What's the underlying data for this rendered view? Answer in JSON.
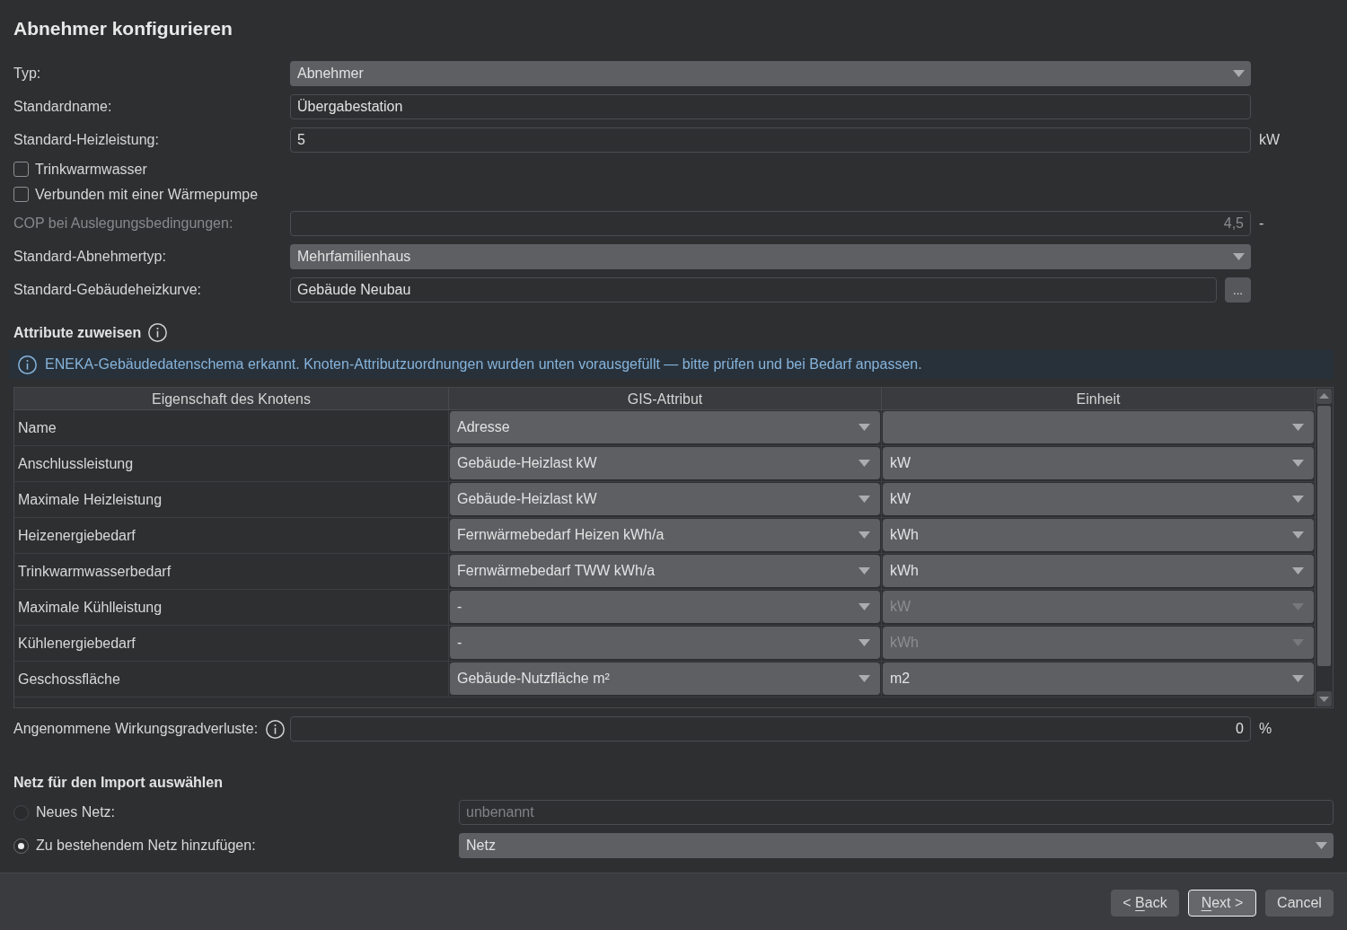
{
  "dialog": {
    "title": "Abnehmer konfigurieren"
  },
  "settings": [
    {
      "kind": "dropdown",
      "label": "Typ:",
      "value": "Abnehmer",
      "disabled": false
    },
    {
      "kind": "text",
      "label": "Standardname:",
      "value": "Übergabestation",
      "disabled": false
    },
    {
      "kind": "text",
      "label": "Standard-Heizleistung:",
      "value": "5",
      "unit": "kW",
      "disabled": false
    },
    {
      "kind": "checkbox",
      "label": "Trinkwarmwasser",
      "checked": false,
      "disabled": false
    },
    {
      "kind": "checkbox",
      "label": "Verbunden mit einer Wärmepumpe",
      "checked": false,
      "disabled": false
    },
    {
      "kind": "number",
      "label": "COP bei Auslegungsbedingungen:",
      "value": "4,5",
      "unit": "-",
      "disabled": true
    },
    {
      "kind": "dropdown",
      "label": "Standard-Abnehmertyp:",
      "value": "Mehrfamilienhaus",
      "disabled": false
    },
    {
      "kind": "browse",
      "label": "Standard-Gebäudeheizkurve:",
      "value": "Gebäude Neubau",
      "button": "...",
      "disabled": false
    }
  ],
  "attributes": {
    "title": "Attribute zuweisen",
    "notice": "ENEKA-Gebäudedatenschema erkannt. Knoten-Attributzuordnungen wurden unten vorausgefüllt — bitte prüfen und bei Bedarf anpassen.",
    "table": {
      "columns": [
        "Eigenschaft des Knotens",
        "GIS-Attribut",
        "Einheit"
      ],
      "rows": [
        {
          "property": "Name",
          "gis_attribute": {
            "value": "Adresse",
            "disabled": false
          },
          "unit": {
            "disabled": false
          }
        },
        {
          "property": "Anschlussleistung",
          "gis_attribute": {
            "value": "Gebäude-Heizlast kW",
            "disabled": false
          },
          "unit": {
            "value": "kW",
            "disabled": false
          }
        },
        {
          "property": "Maximale Heizleistung",
          "gis_attribute": {
            "value": "Gebäude-Heizlast kW",
            "disabled": false
          },
          "unit": {
            "value": "kW",
            "disabled": false
          }
        },
        {
          "property": "Heizenergiebedarf",
          "gis_attribute": {
            "value": "Fernwärmebedarf Heizen kWh/a",
            "disabled": false
          },
          "unit": {
            "value": "kWh",
            "disabled": false
          }
        },
        {
          "property": "Trinkwarmwasserbedarf",
          "gis_attribute": {
            "value": "Fernwärmebedarf TWW kWh/a",
            "disabled": false
          },
          "unit": {
            "value": "kWh",
            "disabled": false
          }
        },
        {
          "property": "Maximale Kühlleistung",
          "gis_attribute": {
            "value": "-",
            "disabled": false
          },
          "unit": {
            "value": "kW",
            "disabled": true
          }
        },
        {
          "property": "Kühlenergiebedarf",
          "gis_attribute": {
            "value": "-",
            "disabled": false
          },
          "unit": {
            "value": "kWh",
            "disabled": true
          }
        },
        {
          "property": "Geschossfläche",
          "gis_attribute": {
            "value": "Gebäude-Nutzfläche m²",
            "disabled": false
          },
          "unit": {
            "value": "m2",
            "disabled": false
          }
        }
      ]
    }
  },
  "efficiency_loss": {
    "label": "Angenommene Wirkungsgradverluste:",
    "value": "0",
    "unit": "%"
  },
  "network": {
    "title": "Netz für den Import auswählen",
    "options": [
      {
        "kind": "text",
        "label": "Neues Netz:",
        "selected": false,
        "placeholder": "unbenannt"
      },
      {
        "kind": "dropdown",
        "label": "Zu bestehendem Netz hinzufügen:",
        "selected": true,
        "value": "Netz"
      }
    ]
  },
  "buttons": [
    {
      "label": "< Back",
      "mnemonic": true,
      "default": false
    },
    {
      "label": "Next >",
      "mnemonic": true,
      "default": true
    },
    {
      "label": "Cancel",
      "mnemonic": false,
      "default": false
    }
  ]
}
